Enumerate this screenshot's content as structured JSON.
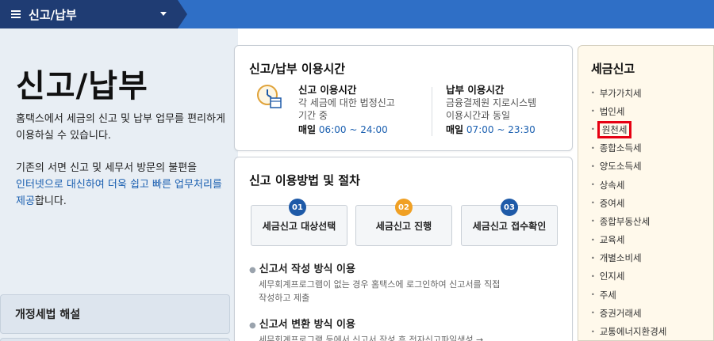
{
  "header": {
    "title": "신고/납부"
  },
  "left": {
    "page_title": "신고/납부",
    "intro": "홈택스에서 세금의 신고 및 납부 업무를 편리하게 이용하실 수 있습니다.",
    "intro2_prefix": "기존의 서면 신고 및 세무서 방문의 불편을",
    "intro2_link": "인터넷으로 대신하여 더욱 쉽고 빠른 업무처리를 제공",
    "intro2_suffix": "합니다.",
    "law_card": "개정세법 해설"
  },
  "hours": {
    "title": "신고/납부 이용시간",
    "filing": {
      "head": "신고 이용시간",
      "line1": "각 세금에 대한 법정신고",
      "line2": "기간 중",
      "daily": "매일",
      "time": "06:00 ~ 24:00"
    },
    "payment": {
      "head": "납부 이용시간",
      "line1": "금융결제원 지로시스템",
      "line2": "이용시간과 동일",
      "daily": "매일",
      "time": "07:00 ~ 23:30"
    }
  },
  "procedure": {
    "title": "신고 이용방법 및 절차",
    "steps": [
      {
        "num": "01",
        "label": "세금신고 대상선택",
        "color": "#1e5aa8"
      },
      {
        "num": "02",
        "label": "세금신고 진행",
        "color": "#f0a024"
      },
      {
        "num": "03",
        "label": "세금신고 접수확인",
        "color": "#1e5aa8"
      }
    ],
    "methods": [
      {
        "title": "신고서 작성 방식 이용",
        "desc1": "세무회계프로그램이 없는 경우 홈택스에 로그인하여 신고서를 직접",
        "desc2": "작성하고 제출"
      },
      {
        "title": "신고서 변환 방식 이용",
        "desc1": "세무회계프로그램 등에서 신고서 작성 후 전자신고파일생성 →"
      }
    ]
  },
  "tax_filing": {
    "title": "세금신고",
    "items": [
      "부가가치세",
      "법인세",
      "원천세",
      "종합소득세",
      "양도소득세",
      "상속세",
      "증여세",
      "종합부동산세",
      "교육세",
      "개별소비세",
      "인지세",
      "주세",
      "증권거래세",
      "교통에너지환경세"
    ],
    "selected": "원천세"
  }
}
